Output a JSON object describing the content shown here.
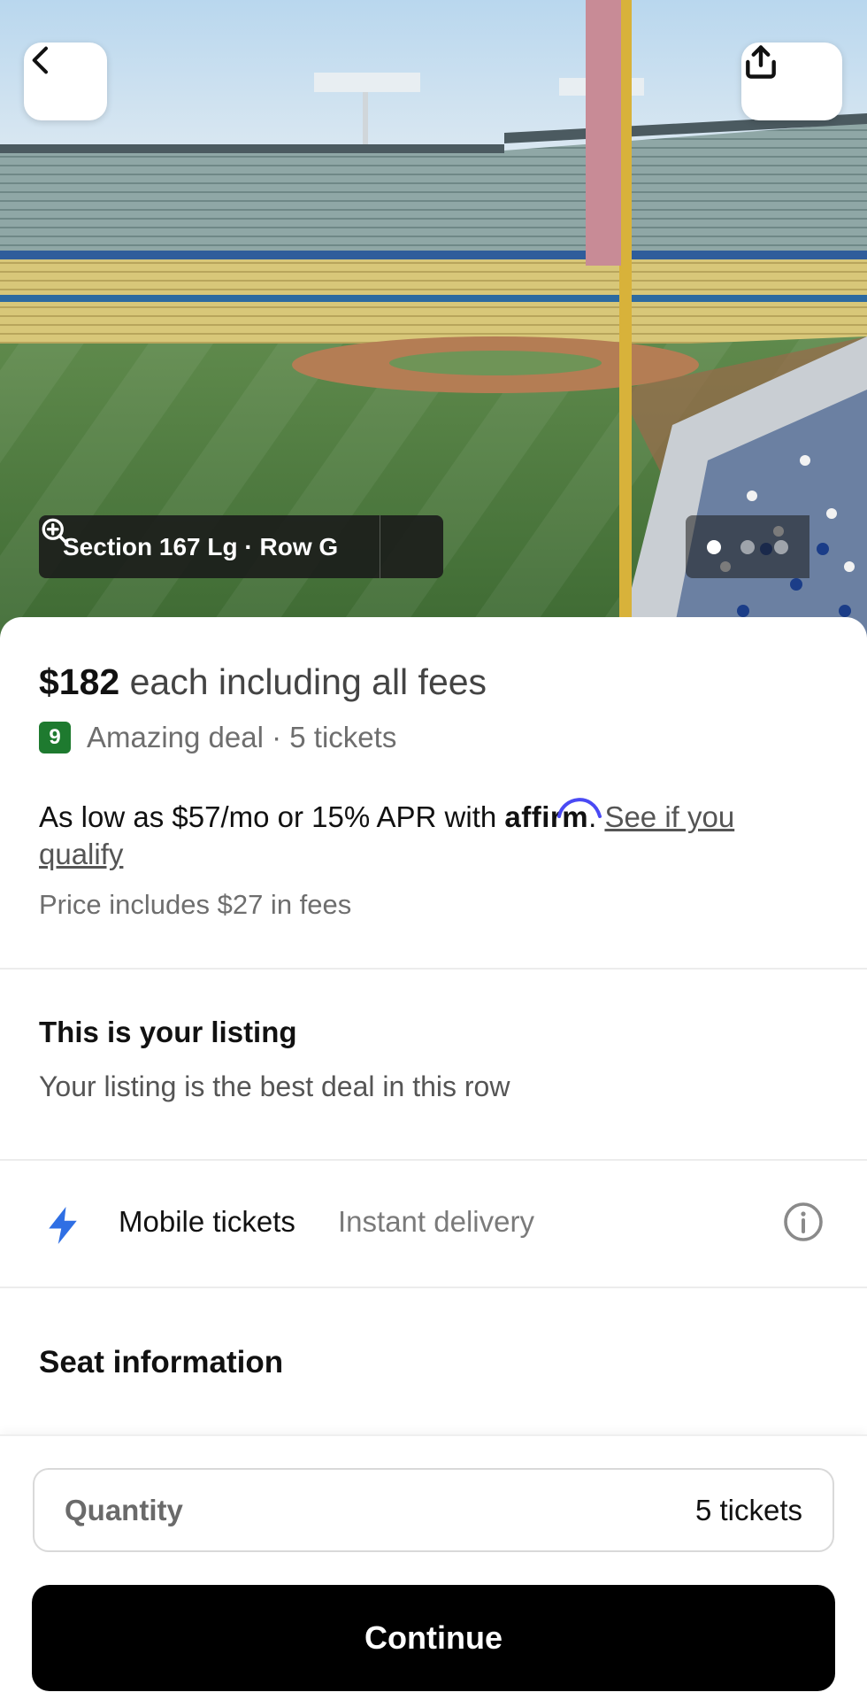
{
  "hero": {
    "section_label": "Section 167 Lg · Row G",
    "image_dots": 3,
    "active_dot": 0
  },
  "price": {
    "amount": "$182",
    "suffix": " each including all fees"
  },
  "deal": {
    "score": "9",
    "text": "Amazing deal · 5 tickets",
    "badge_color": "#1e7a2f"
  },
  "financing": {
    "prefix": "As low as $57/mo or 15% APR with ",
    "brand": "affirm",
    "brand_arc_color": "#4a4af4",
    "period": ". ",
    "link": "See if you qualify"
  },
  "fees_note": "Price includes $27 in fees",
  "listing": {
    "title": "This is your listing",
    "subtitle": "Your listing is the best deal in this row"
  },
  "delivery": {
    "title": "Mobile tickets",
    "subtitle": "Instant delivery",
    "icon_color": "#2f6fe4"
  },
  "seat_info": {
    "title": "Seat information"
  },
  "quantity": {
    "label": "Quantity",
    "value": "5 tickets"
  },
  "continue_label": "Continue",
  "icons": {
    "back": "chevron-left-icon",
    "share": "share-icon",
    "zoom": "zoom-in-icon",
    "bolt": "lightning-bolt-icon",
    "info": "info-icon"
  }
}
